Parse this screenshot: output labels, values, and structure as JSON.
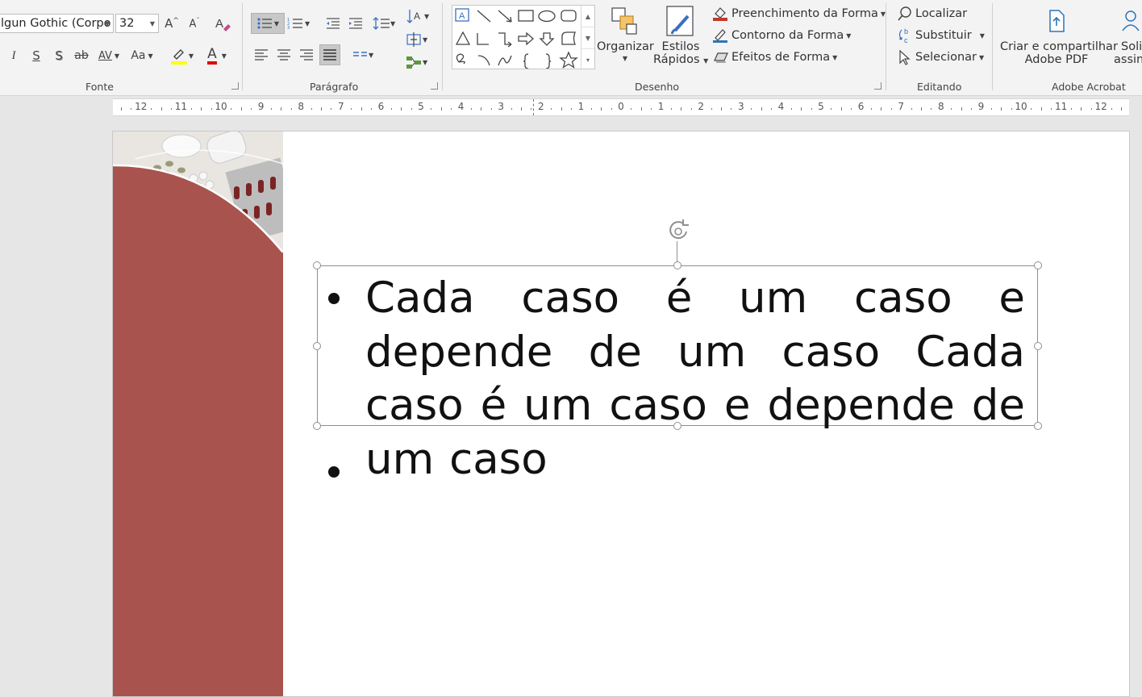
{
  "ribbon": {
    "font_group": {
      "label": "Fonte",
      "font_name": "lgun Gothic (Corpo",
      "font_size": "32",
      "grow_font_icon": "A^",
      "shrink_font_icon": "A^",
      "italic": "I",
      "underline": "S",
      "shadow": "S",
      "strikethrough": "ab",
      "char_spacing": "AV",
      "change_case": "Aa",
      "font_color_letter": "A",
      "highlight_color": "#ffff00",
      "font_color": "#e00000"
    },
    "paragraph_group": {
      "label": "Parágrafo"
    },
    "drawing_group": {
      "label": "Desenho",
      "arrange": "Organizar",
      "quick_styles_line1": "Estilos",
      "quick_styles_line2": "Rápidos",
      "shape_fill": "Preenchimento da Forma",
      "shape_outline": "Contorno da Forma",
      "shape_effects": "Efeitos de Forma"
    },
    "editing_group": {
      "label": "Editando",
      "find": "Localizar",
      "replace": "Substituir",
      "select": "Selecionar"
    },
    "acrobat_group": {
      "label": "Adobe Acrobat",
      "create_share_line1": "Criar e compartilhar",
      "create_share_line2": "Adobe PDF",
      "request_line1": "Soli",
      "request_line2": "assina"
    }
  },
  "ruler": {
    "left_numbers": [
      "12",
      "11",
      "10",
      "9",
      "8",
      "7",
      "6",
      "5",
      "4",
      "3",
      "2",
      "1",
      "0"
    ],
    "right_numbers": [
      "1",
      "2",
      "3",
      "4",
      "5",
      "6",
      "7",
      "8",
      "9",
      "10",
      "11",
      "12"
    ]
  },
  "slide": {
    "bullet1": "Cada caso é um caso e depende de um caso Cada caso é um caso e depende de um caso",
    "bullet2": ""
  }
}
